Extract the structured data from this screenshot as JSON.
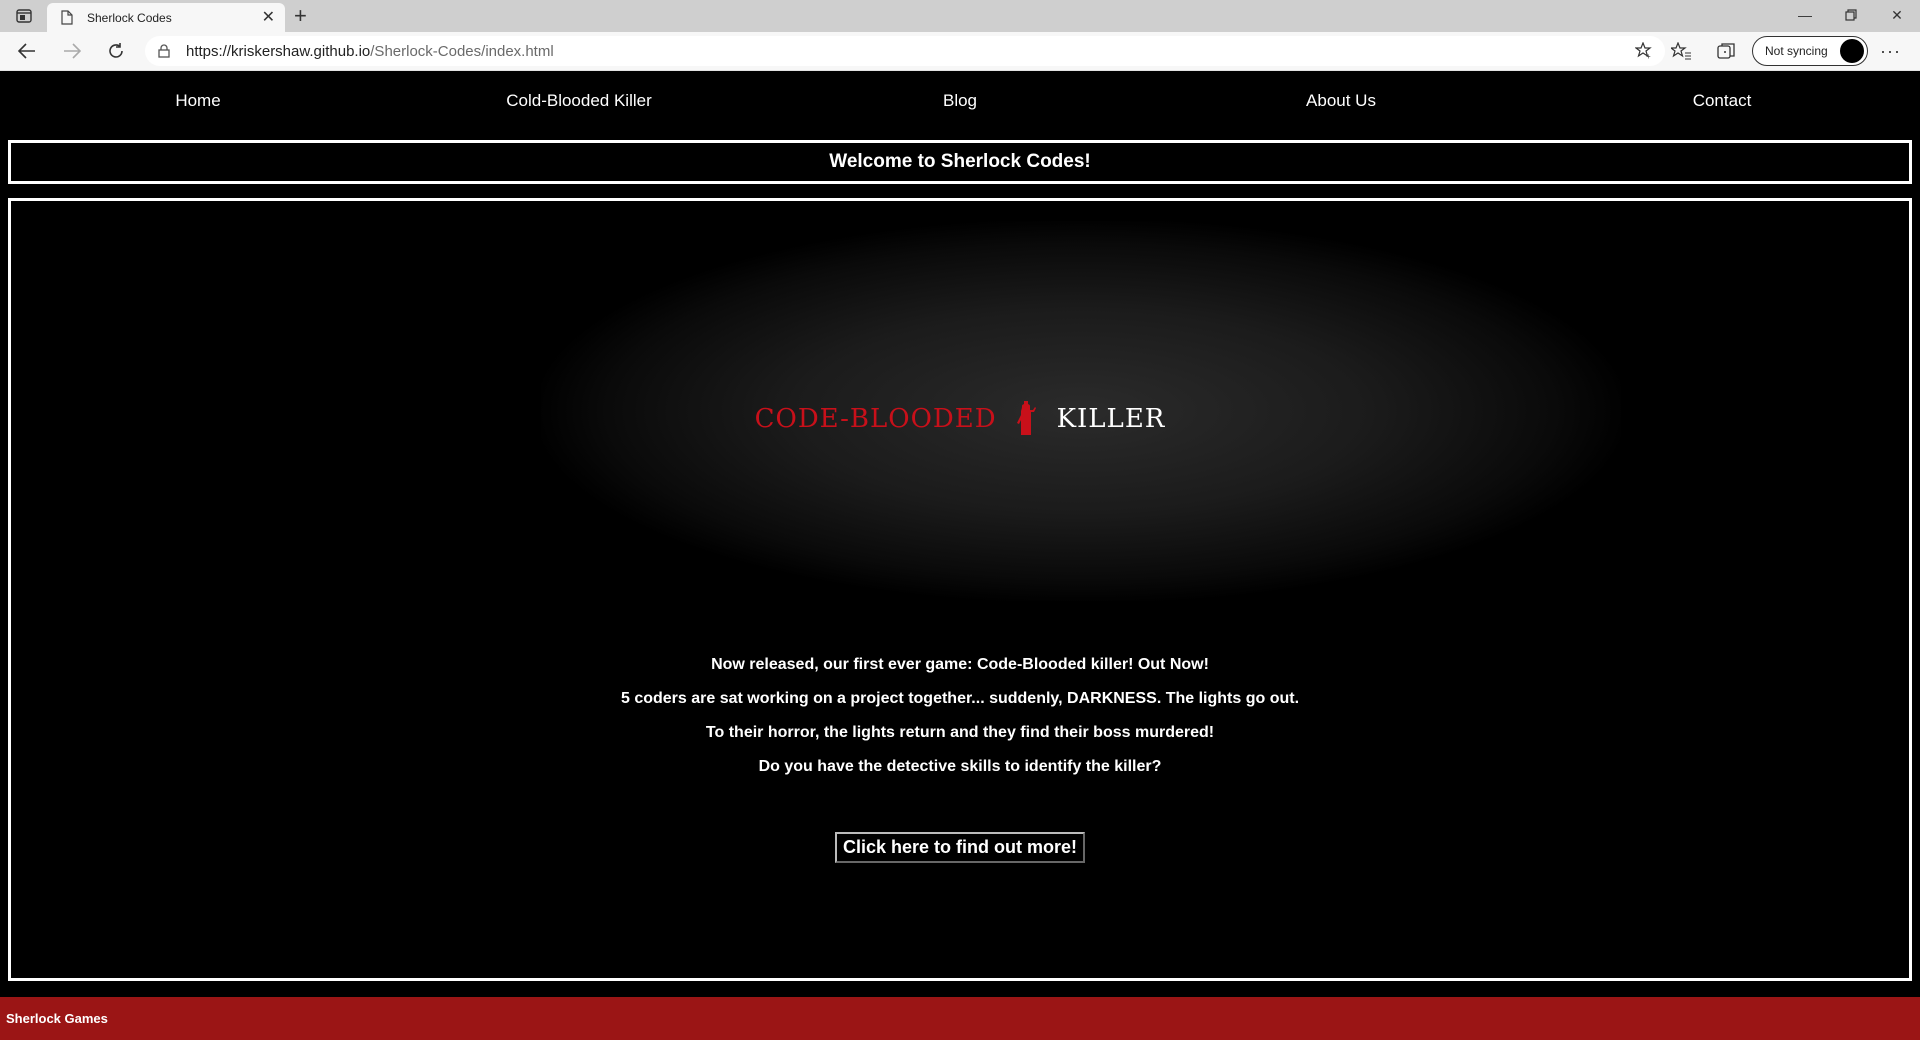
{
  "browser": {
    "tab_title": "Sherlock Codes",
    "url_host": "https://kriskershaw.github.io",
    "url_path": "/Sherlock-Codes/index.html",
    "sync_label": "Not syncing",
    "more_label": "···"
  },
  "nav": {
    "items": [
      "Home",
      "Cold-Blooded Killer",
      "Blog",
      "About Us",
      "Contact"
    ]
  },
  "welcome": "Welcome to Sherlock Codes!",
  "logo": {
    "left_text": "CODE-BLOODED",
    "right_text": "KILLER",
    "accent_color": "#c8101a"
  },
  "intro": [
    "Now released, our first ever game: Code-Blooded killer! Out Now!",
    "5 coders are sat working on a project together... suddenly, DARKNESS. The lights go out.",
    "To their horror, the lights return and they find their boss murdered!",
    "Do you have the detective skills to identify the killer?"
  ],
  "cta_label": "Click here to find out more!",
  "footer": {
    "text": "Sherlock Games",
    "color": "#9b1515"
  }
}
